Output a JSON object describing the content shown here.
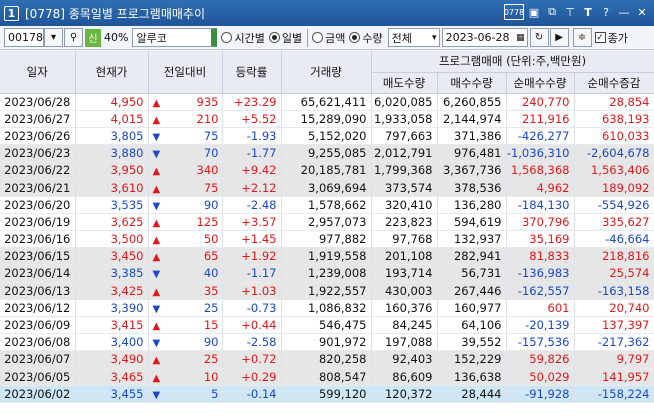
{
  "window": {
    "number": "1",
    "title": "[0778] 종목일별 프로그램매매추이",
    "icons": [
      "0778-code-icon",
      "window-icon",
      "copy-icon",
      "pin-icon",
      "text-icon",
      "help-icon",
      "minimize-icon",
      "close-icon"
    ],
    "code_button": "0778"
  },
  "toolbar": {
    "stock_code": "001780",
    "sin_badge": "신",
    "ratio": "40%",
    "stock_name": "알루코",
    "period_options": [
      "시간별",
      "일별"
    ],
    "period_selected": "일별",
    "unit_options": [
      "금액",
      "수량"
    ],
    "unit_selected": "수량",
    "market": "전체",
    "date": "2023-06-28",
    "chart_check_label": "종가",
    "chart_checked": true
  },
  "table": {
    "headers": {
      "date": "일자",
      "price": "현재가",
      "change": "전일대비",
      "rate": "등락률",
      "volume": "거래량",
      "group": "프로그램매매 (단위:주,백만원)",
      "sell": "매도수량",
      "buy": "매수수량",
      "net": "순매수수량",
      "net_chg": "순매수증감"
    },
    "rows": [
      {
        "date": "2023/06/28",
        "price": "4,950",
        "dir": "up",
        "change": "935",
        "rate": "+23.29",
        "volume": "65,621,411",
        "sell": "6,020,085",
        "buy": "6,260,855",
        "net": "240,770",
        "net_chg": "28,854"
      },
      {
        "date": "2023/06/27",
        "price": "4,015",
        "dir": "up",
        "change": "210",
        "rate": "+5.52",
        "volume": "15,289,090",
        "sell": "1,933,058",
        "buy": "2,144,974",
        "net": "211,916",
        "net_chg": "638,193"
      },
      {
        "date": "2023/06/26",
        "price": "3,805",
        "dir": "dn",
        "change": "75",
        "rate": "-1.93",
        "volume": "5,152,020",
        "sell": "797,663",
        "buy": "371,386",
        "net": "-426,277",
        "net_chg": "610,033"
      },
      {
        "date": "2023/06/23",
        "price": "3,880",
        "dir": "dn",
        "change": "70",
        "rate": "-1.77",
        "volume": "9,255,085",
        "sell": "2,012,791",
        "buy": "976,481",
        "net": "-1,036,310",
        "net_chg": "-2,604,678"
      },
      {
        "date": "2023/06/22",
        "price": "3,950",
        "dir": "up",
        "change": "340",
        "rate": "+9.42",
        "volume": "20,185,781",
        "sell": "1,799,368",
        "buy": "3,367,736",
        "net": "1,568,368",
        "net_chg": "1,563,406"
      },
      {
        "date": "2023/06/21",
        "price": "3,610",
        "dir": "up",
        "change": "75",
        "rate": "+2.12",
        "volume": "3,069,694",
        "sell": "373,574",
        "buy": "378,536",
        "net": "4,962",
        "net_chg": "189,092"
      },
      {
        "date": "2023/06/20",
        "price": "3,535",
        "dir": "dn",
        "change": "90",
        "rate": "-2.48",
        "volume": "1,578,662",
        "sell": "320,410",
        "buy": "136,280",
        "net": "-184,130",
        "net_chg": "-554,926"
      },
      {
        "date": "2023/06/19",
        "price": "3,625",
        "dir": "up",
        "change": "125",
        "rate": "+3.57",
        "volume": "2,957,073",
        "sell": "223,823",
        "buy": "594,619",
        "net": "370,796",
        "net_chg": "335,627"
      },
      {
        "date": "2023/06/16",
        "price": "3,500",
        "dir": "up",
        "change": "50",
        "rate": "+1.45",
        "volume": "977,882",
        "sell": "97,768",
        "buy": "132,937",
        "net": "35,169",
        "net_chg": "-46,664"
      },
      {
        "date": "2023/06/15",
        "price": "3,450",
        "dir": "up",
        "change": "65",
        "rate": "+1.92",
        "volume": "1,919,558",
        "sell": "201,108",
        "buy": "282,941",
        "net": "81,833",
        "net_chg": "218,816"
      },
      {
        "date": "2023/06/14",
        "price": "3,385",
        "dir": "dn",
        "change": "40",
        "rate": "-1.17",
        "volume": "1,239,008",
        "sell": "193,714",
        "buy": "56,731",
        "net": "-136,983",
        "net_chg": "25,574"
      },
      {
        "date": "2023/06/13",
        "price": "3,425",
        "dir": "up",
        "change": "35",
        "rate": "+1.03",
        "volume": "1,922,557",
        "sell": "430,003",
        "buy": "267,446",
        "net": "-162,557",
        "net_chg": "-163,158"
      },
      {
        "date": "2023/06/12",
        "price": "3,390",
        "dir": "dn",
        "change": "25",
        "rate": "-0.73",
        "volume": "1,086,832",
        "sell": "160,376",
        "buy": "160,977",
        "net": "601",
        "net_chg": "20,740"
      },
      {
        "date": "2023/06/09",
        "price": "3,415",
        "dir": "up",
        "change": "15",
        "rate": "+0.44",
        "volume": "546,475",
        "sell": "84,245",
        "buy": "64,106",
        "net": "-20,139",
        "net_chg": "137,397"
      },
      {
        "date": "2023/06/08",
        "price": "3,400",
        "dir": "dn",
        "change": "90",
        "rate": "-2.58",
        "volume": "901,972",
        "sell": "197,088",
        "buy": "39,552",
        "net": "-157,536",
        "net_chg": "-217,362"
      },
      {
        "date": "2023/06/07",
        "price": "3,490",
        "dir": "up",
        "change": "25",
        "rate": "+0.72",
        "volume": "820,258",
        "sell": "92,403",
        "buy": "152,229",
        "net": "59,826",
        "net_chg": "9,797"
      },
      {
        "date": "2023/06/05",
        "price": "3,465",
        "dir": "up",
        "change": "10",
        "rate": "+0.29",
        "volume": "808,547",
        "sell": "86,609",
        "buy": "136,638",
        "net": "50,029",
        "net_chg": "141,957"
      },
      {
        "date": "2023/06/02",
        "price": "3,455",
        "dir": "dn",
        "change": "5",
        "rate": "-0.14",
        "volume": "599,120",
        "sell": "120,372",
        "buy": "28,444",
        "net": "-91,928",
        "net_chg": "-158,224"
      }
    ]
  }
}
